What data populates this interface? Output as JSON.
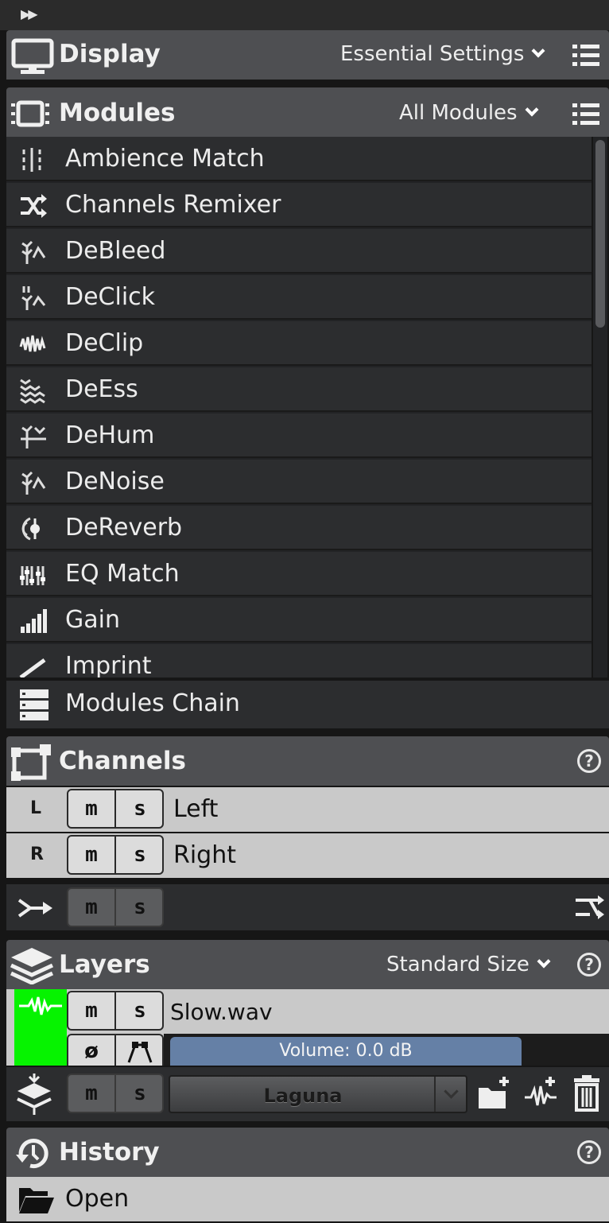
{
  "toolbar": {
    "expand_glyph": "▶▶"
  },
  "display": {
    "title": "Display",
    "preset": "Essential Settings"
  },
  "modules": {
    "title": "Modules",
    "filter": "All Modules",
    "items": [
      {
        "label": "Ambience Match",
        "icon": "ambience-match-icon"
      },
      {
        "label": "Channels Remixer",
        "icon": "channels-remixer-icon"
      },
      {
        "label": "DeBleed",
        "icon": "debleed-icon"
      },
      {
        "label": "DeClick",
        "icon": "declick-icon"
      },
      {
        "label": "DeClip",
        "icon": "declip-icon"
      },
      {
        "label": "DeEss",
        "icon": "deess-icon"
      },
      {
        "label": "DeHum",
        "icon": "dehum-icon"
      },
      {
        "label": "DeNoise",
        "icon": "denoise-icon"
      },
      {
        "label": "DeReverb",
        "icon": "dereverb-icon"
      },
      {
        "label": "EQ Match",
        "icon": "eq-match-icon"
      },
      {
        "label": "Gain",
        "icon": "gain-icon"
      },
      {
        "label": "Imprint",
        "icon": "imprint-icon"
      }
    ],
    "chain_label": "Modules Chain"
  },
  "channels": {
    "title": "Channels",
    "help": "?",
    "rows": [
      {
        "letter": "L",
        "mute": "m",
        "solo": "s",
        "name": "Left"
      },
      {
        "letter": "R",
        "mute": "m",
        "solo": "s",
        "name": "Right"
      }
    ],
    "remix": {
      "mute": "m",
      "solo": "s"
    }
  },
  "layers": {
    "title": "Layers",
    "size": "Standard Size",
    "help": "?",
    "layer": {
      "name": "Slow.wav",
      "mute": "m",
      "solo": "s",
      "phase": "ø",
      "volume": "Volume: 0.0 dB",
      "color": "#06f300"
    },
    "controls": {
      "mute": "m",
      "solo": "s",
      "preset": "Laguna"
    }
  },
  "history": {
    "title": "History",
    "help": "?",
    "items": [
      {
        "label": "Open"
      }
    ]
  }
}
